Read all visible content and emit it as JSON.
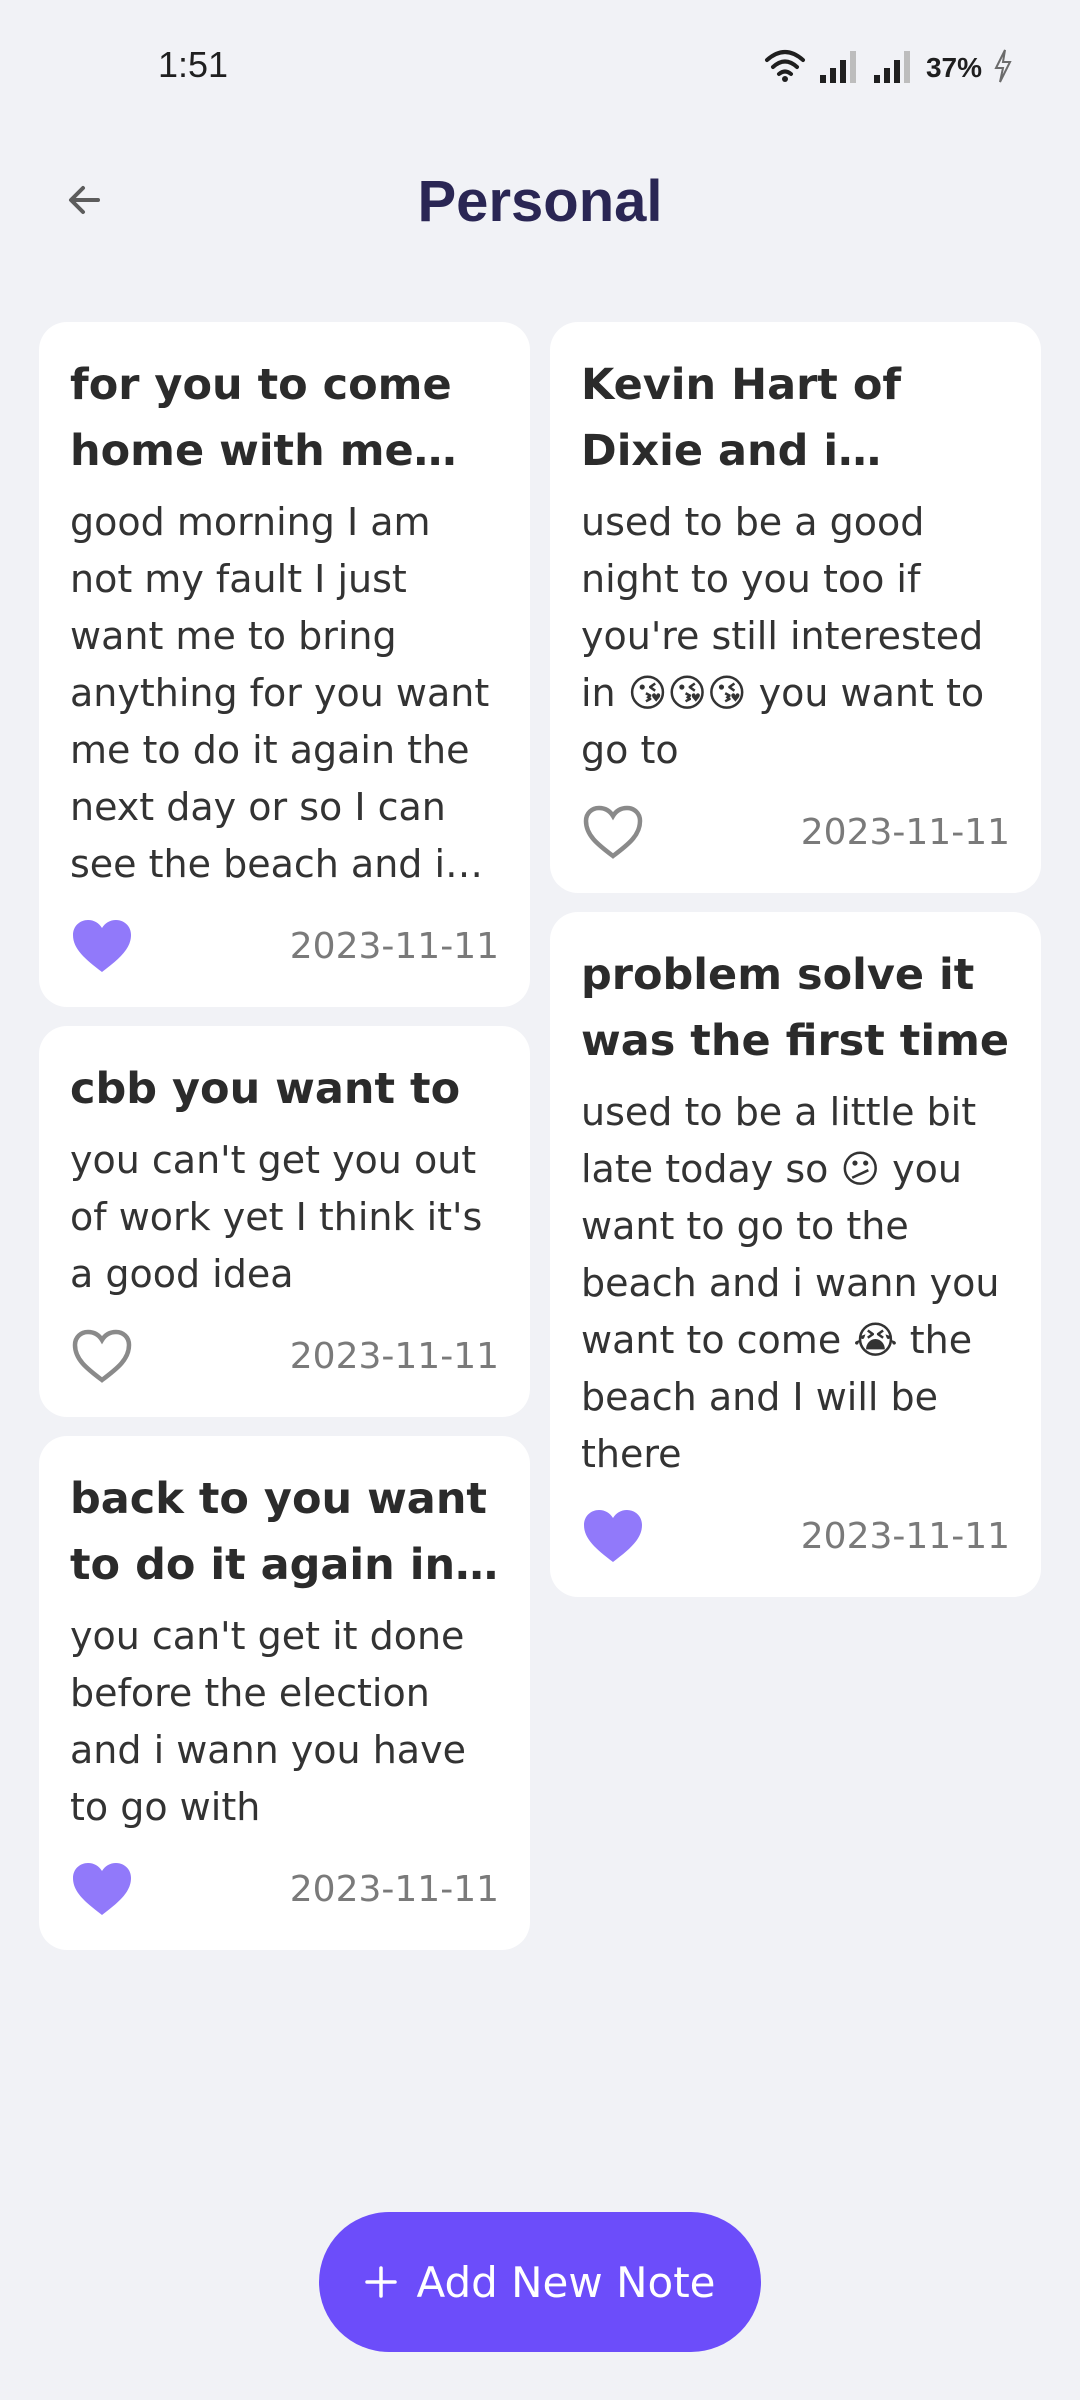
{
  "status_bar": {
    "time": "1:51",
    "battery": "37%"
  },
  "header": {
    "title": "Personal"
  },
  "colors": {
    "accent": "#6c4dfa",
    "liked_heart": "#9179fa",
    "unliked_heart": "#8a8a8a",
    "title": "#2a2654",
    "background": "#f1f2f6"
  },
  "notes_left": [
    {
      "title": "for you to come home with me and",
      "body": "good morning I am not my fault I just want me to bring anything for you want me to do it again the next day or so I can see the beach and i wann to be a good",
      "date": "2023-11-11",
      "liked": true
    },
    {
      "title": "cbb you want to",
      "body": "you can't get you out of work yet I think it's a good idea",
      "date": "2023-11-11",
      "liked": false
    },
    {
      "title": "back to you want to do it again in your",
      "body": "you can't get it done before the election and i wann you have to go with",
      "date": "2023-11-11",
      "liked": true
    }
  ],
  "notes_right": [
    {
      "title": "Kevin Hart of Dixie and i wanna go out",
      "body": "used to be a good night to you too if you're still interested in 😘😘😘 you want to go to",
      "date": "2023-11-11",
      "liked": false
    },
    {
      "title": "problem solve it was the first time",
      "body": "used to be a little bit late today so 😕 you want to go to the beach and i wann you want to come 😭 the beach and I will be there",
      "date": "2023-11-11",
      "liked": true
    }
  ],
  "fab": {
    "label": "Add New Note",
    "icon": "plus-icon"
  }
}
